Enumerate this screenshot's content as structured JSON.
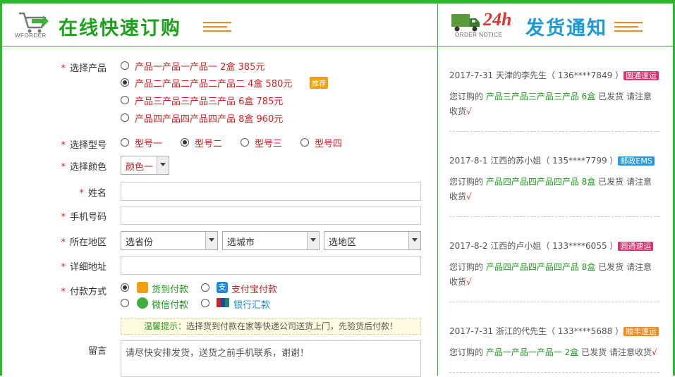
{
  "header_left": {
    "caption": "WFORDER",
    "title": "在线快速订购"
  },
  "header_right": {
    "caption": "ORDER NOTICE",
    "h24": "24h",
    "title": "发货通知"
  },
  "form": {
    "product_label": "选择产品",
    "products": [
      {
        "text": "产品一产品一产品一 2盒 385元",
        "selected": false
      },
      {
        "text": "产品二产品二产品二产品二 4盒 580元",
        "selected": true,
        "badge": "推荐"
      },
      {
        "text": "产品三产品三产品三产品 6盒 785元",
        "selected": false
      },
      {
        "text": "产品四产品四产品四产品 8盒 960元",
        "selected": false
      }
    ],
    "model_label": "选择型号",
    "models": [
      {
        "text": "型号一",
        "selected": false
      },
      {
        "text": "型号二",
        "selected": true
      },
      {
        "text": "型号三",
        "selected": false
      },
      {
        "text": "型号四",
        "selected": false
      }
    ],
    "color_label": "选择颜色",
    "color_value": "颜色一",
    "name_label": "姓名",
    "phone_label": "手机号码",
    "region_label": "所在地区",
    "province": "选省份",
    "city": "选城市",
    "district": "选地区",
    "address_label": "详细地址",
    "payment_label": "付款方式",
    "payments": [
      {
        "text": "货到付款",
        "selected": true,
        "color": "#1a9a1a",
        "icon": "cod-icon",
        "icon_color": "#f0a010"
      },
      {
        "text": "支付宝付款",
        "selected": false,
        "color": "#d42020",
        "icon": "alipay-icon",
        "icon_color": "#1a8ad6"
      },
      {
        "text": "微信付款",
        "selected": false,
        "color": "#1a9a1a",
        "icon": "wechat-icon",
        "icon_color": "#3fae3f"
      },
      {
        "text": "银行汇款",
        "selected": false,
        "color": "#1a8ad6",
        "icon": "unionpay-icon",
        "icon_color": "#d42020"
      }
    ],
    "tip_label": "温馨提示：",
    "tip_text": "选择货到付款在家等快递公司送货上门，先验货后付款！",
    "message_label": "留言",
    "message_value": "请尽快安排发货，送货之前手机联系，谢谢！"
  },
  "notices": [
    {
      "date": "2017-7-31",
      "who": "天津的李先生",
      "phone": "136****7849",
      "ship": "圆通速运",
      "ship_color": "#e0306a",
      "prefix": "您订购的",
      "product": "产品三产品三产品三产品 6盒",
      "suffix": "已发货 请注意收货",
      "check": "√"
    },
    {
      "date": "2017-8-1",
      "who": "江西的苏小姐",
      "phone": "135****7799",
      "ship": "邮政EMS",
      "ship_color": "#2a9ae0",
      "prefix": "您订购的",
      "product": "产品四产品四产品四产品 8盒",
      "suffix": "已发货 请注意收货",
      "check": "√"
    },
    {
      "date": "2017-8-2",
      "who": "江西的卢小姐",
      "phone": "133****6055",
      "ship": "圆通速运",
      "ship_color": "#e0306a",
      "prefix": "您订购的",
      "product": "产品四产品四产品四产品 8盒",
      "suffix": "已发货 请注意收货",
      "check": "√"
    },
    {
      "date": "2017-7-31",
      "who": "浙江的代先生",
      "phone": "133****5688",
      "ship": "顺丰速运",
      "ship_color": "#f08a1c",
      "prefix": "您订购的",
      "product": "产品一产品一产品一 2盒",
      "suffix": "已发货 请注意收货",
      "check": "√"
    }
  ]
}
